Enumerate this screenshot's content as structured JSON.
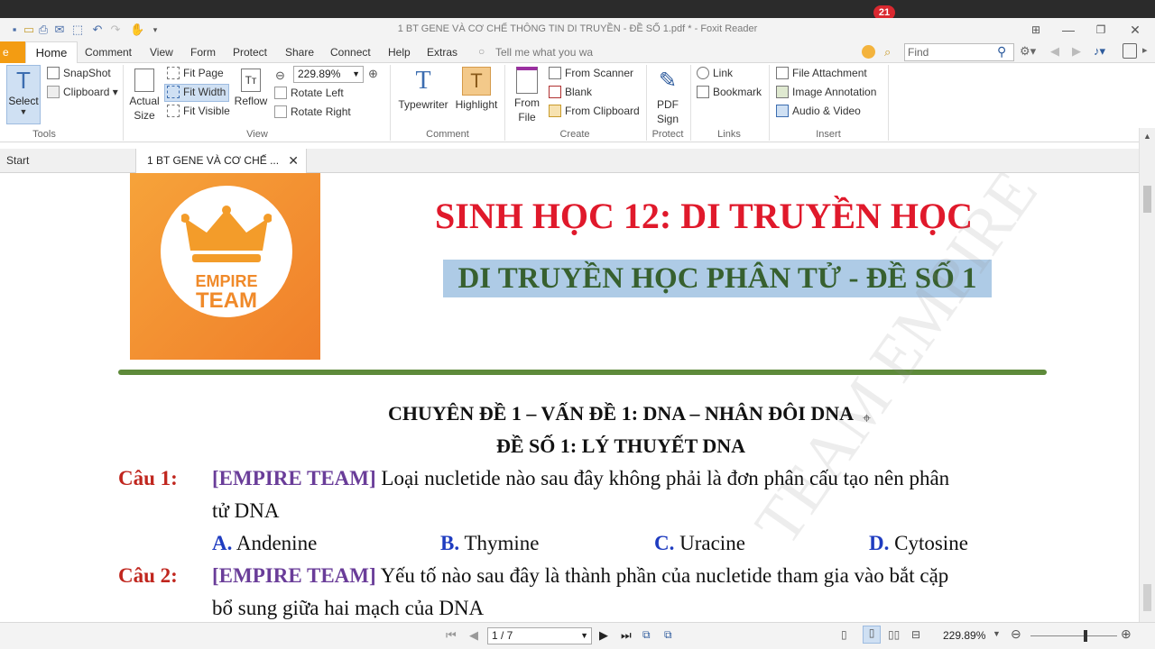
{
  "window": {
    "title": "1 BT GENE VÀ CƠ CHẾ THÔNG TIN DI TRUYỀN - ĐỀ SỐ 1.pdf * - Foxit Reader",
    "notification_count": "21"
  },
  "menu": {
    "file": "e",
    "tabs": [
      "Home",
      "Comment",
      "View",
      "Form",
      "Protect",
      "Share",
      "Connect",
      "Help",
      "Extras"
    ],
    "tell_me": "Tell me what you wa",
    "find_placeholder": "Find"
  },
  "ribbon": {
    "tools": {
      "label": "Tools",
      "select": "Select",
      "snapshot": "SnapShot",
      "clipboard": "Clipboard"
    },
    "view": {
      "label": "View",
      "actual_size_1": "Actual",
      "actual_size_2": "Size",
      "fit_page": "Fit Page",
      "fit_width": "Fit Width",
      "fit_visible": "Fit Visible",
      "reflow": "Reflow",
      "zoom": "229.89%",
      "rotate_left": "Rotate Left",
      "rotate_right": "Rotate Right"
    },
    "comment": {
      "label": "Comment",
      "typewriter": "Typewriter",
      "highlight": "Highlight"
    },
    "create": {
      "label": "Create",
      "from_file_1": "From",
      "from_file_2": "File",
      "from_scanner": "From Scanner",
      "blank": "Blank",
      "from_clipboard": "From Clipboard"
    },
    "protect": {
      "label": "Protect",
      "pdf_sign_1": "PDF",
      "pdf_sign_2": "Sign"
    },
    "links": {
      "label": "Links",
      "link": "Link",
      "bookmark": "Bookmark"
    },
    "insert": {
      "label": "Insert",
      "file_attachment": "File Attachment",
      "image_annotation": "Image Annotation",
      "audio_video": "Audio & Video"
    }
  },
  "tabs": {
    "start": "Start",
    "doc": "1 BT GENE VÀ CƠ CHẾ ..."
  },
  "document": {
    "logo_line1": "EMPIRE",
    "logo_line2": "TEAM",
    "title": "SINH HỌC 12: DI TRUYỀN HỌC",
    "subtitle": "DI TRUYỀN HỌC PHÂN TỬ - ĐỀ SỐ 1",
    "topic": "CHUYÊN ĐỀ 1 – VẤN ĐỀ 1: DNA – NHÂN ĐÔI DNA",
    "exam": "ĐỀ SỐ 1: LÝ THUYẾT DNA",
    "watermark": "TEAM EMPIRE",
    "q1": {
      "label": "Câu 1:",
      "tag": "[EMPIRE TEAM]",
      "text1": "Loại nucletide nào sau đây không phải là đơn phân cấu tạo nên phân",
      "text2": "tử DNA",
      "answers": [
        {
          "key": "A.",
          "text": "Andenine"
        },
        {
          "key": "B.",
          "text": "Thymine"
        },
        {
          "key": "C.",
          "text": "Uracine"
        },
        {
          "key": "D.",
          "text": "Cytosine"
        }
      ]
    },
    "q2": {
      "label": "Câu 2:",
      "tag": "[EMPIRE TEAM]",
      "text1": "Yếu tố nào sau đây là thành phần của nucletide tham gia vào bắt cặp",
      "text2": "bổ sung giữa hai mạch của DNA"
    }
  },
  "status": {
    "page": "1 / 7",
    "zoom": "229.89%"
  },
  "colors": {
    "accent": "#f39c12",
    "title_red": "#e0192b",
    "subtitle_green": "#37602f",
    "highlight": "#aecbe6",
    "divider": "#5e8a3a"
  }
}
